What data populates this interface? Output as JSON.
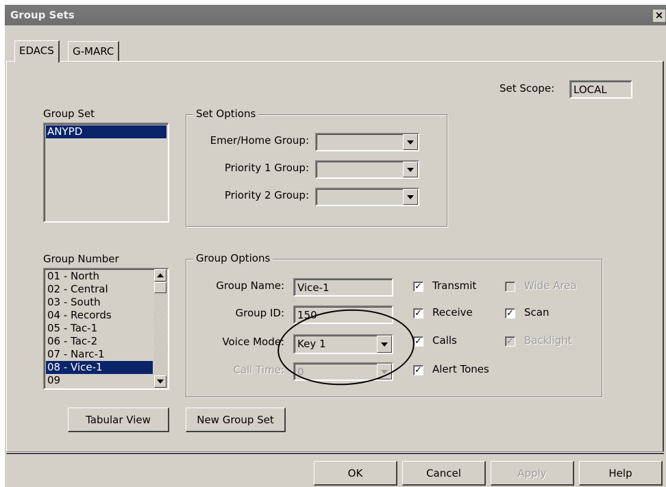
{
  "window": {
    "title": "Group Sets",
    "close_glyph": "×"
  },
  "tabs": [
    {
      "label": "EDACS",
      "active": true
    },
    {
      "label": "G-MARC",
      "active": false
    }
  ],
  "set_scope": {
    "label": "Set Scope:",
    "value": "LOCAL"
  },
  "group_set": {
    "label": "Group Set",
    "items": [
      {
        "text": "ANYPD",
        "selected": true
      }
    ]
  },
  "set_options": {
    "title": "Set Options",
    "emer_home": {
      "label": "Emer/Home Group:",
      "value": ""
    },
    "priority1": {
      "label": "Priority 1 Group:",
      "value": ""
    },
    "priority2": {
      "label": "Priority 2 Group:",
      "value": ""
    }
  },
  "group_number": {
    "label": "Group Number",
    "items": [
      {
        "text": "01  - North",
        "selected": false
      },
      {
        "text": "02  - Central",
        "selected": false
      },
      {
        "text": "03  - South",
        "selected": false
      },
      {
        "text": "04  - Records",
        "selected": false
      },
      {
        "text": "05  - Tac-1",
        "selected": false
      },
      {
        "text": "06  - Tac-2",
        "selected": false
      },
      {
        "text": "07  - Narc-1",
        "selected": false
      },
      {
        "text": "08  - Vice-1",
        "selected": true
      },
      {
        "text": "09",
        "selected": false
      }
    ]
  },
  "group_options": {
    "title": "Group Options",
    "group_name": {
      "label": "Group Name:",
      "value": "Vice-1"
    },
    "group_id": {
      "label": "Group ID:",
      "value": "150"
    },
    "voice_mode": {
      "label": "Voice Mode:",
      "value": "Key 1"
    },
    "call_time": {
      "label": "Call Time:",
      "value": "0",
      "disabled": true
    },
    "checkboxes": {
      "transmit": {
        "label": "Transmit",
        "checked": true,
        "disabled": false
      },
      "receive": {
        "label": "Receive",
        "checked": true,
        "disabled": false
      },
      "calls": {
        "label": "Calls",
        "checked": true,
        "disabled": false
      },
      "alert_tones": {
        "label": "Alert Tones",
        "checked": true,
        "disabled": false
      },
      "wide_area": {
        "label": "Wide Area",
        "checked": false,
        "disabled": true
      },
      "scan": {
        "label": "Scan",
        "checked": true,
        "disabled": false
      },
      "backlight": {
        "label": "Backlight",
        "checked": true,
        "disabled": true
      }
    },
    "check_glyph": "✓"
  },
  "buttons": {
    "tabular_view": "Tabular View",
    "new_group_set": "New Group Set",
    "ok": "OK",
    "cancel": "Cancel",
    "apply": "Apply",
    "help": "Help"
  },
  "colors": {
    "dialog_face": "#d4d0c8",
    "selection": "#0a246a",
    "titlebar_inactive": "#7a7a7a"
  }
}
